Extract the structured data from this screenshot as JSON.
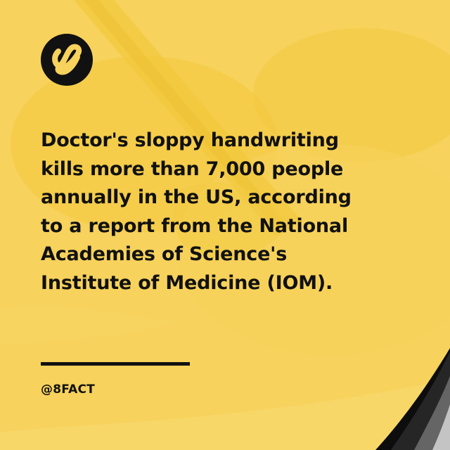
{
  "colors": {
    "background": "#f7d25c",
    "text": "#111111"
  },
  "logo": {
    "icon": "infinity-eight-icon"
  },
  "headline_lines": [
    "Doctor's sloppy handwriting",
    "kills more than 7,000 people",
    "annually in the US, according",
    "to a report from the National",
    "Academies of Science's",
    "Institute of Medicine (IOM)."
  ],
  "handle": "@8FACT"
}
